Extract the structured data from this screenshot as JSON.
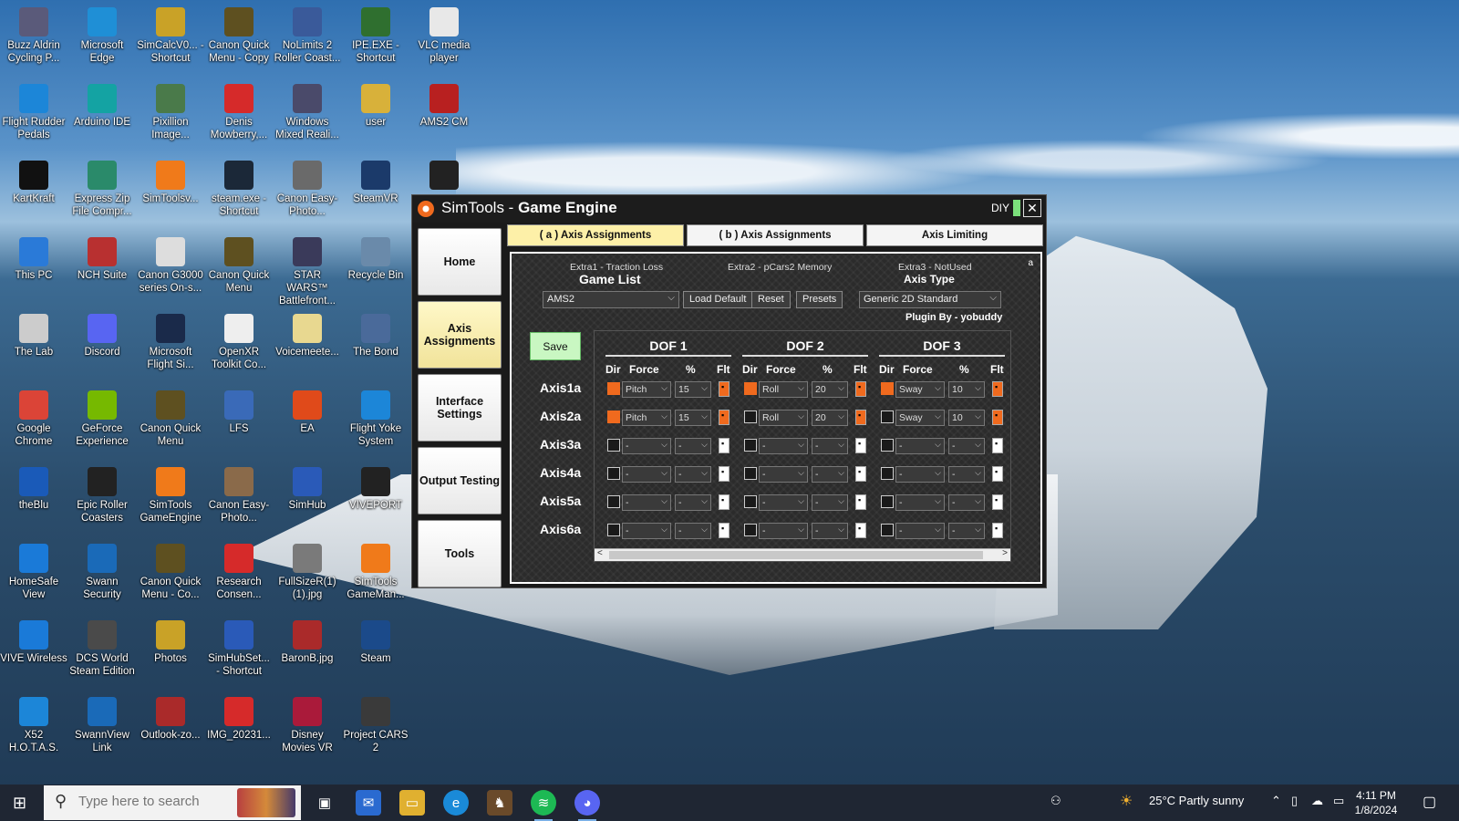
{
  "desktop_icons": [
    {
      "label": "Buzz Aldrin Cycling P...",
      "icon": "cycling-icon",
      "color": "#5a5a7a"
    },
    {
      "label": "Microsoft Edge",
      "icon": "edge-icon",
      "color": "#1f8fd6"
    },
    {
      "label": "SimCalcV0... - Shortcut",
      "icon": "folder-icon",
      "color": "#c9a227"
    },
    {
      "label": "Canon Quick Menu - Copy",
      "icon": "canon-icon",
      "color": "#5e5020"
    },
    {
      "label": "NoLimits 2 Roller Coast...",
      "icon": "coaster-icon",
      "color": "#3a5a9a"
    },
    {
      "label": "IPE.EXE - Shortcut",
      "icon": "sun-icon",
      "color": "#2f6f2f"
    },
    {
      "label": "VLC media player",
      "icon": "file-icon",
      "color": "#e8e8e8"
    },
    {
      "label": "Flight Rudder Pedals",
      "icon": "joystick-icon",
      "color": "#1c86d8"
    },
    {
      "label": "Arduino IDE",
      "icon": "arduino-icon",
      "color": "#14a3a3"
    },
    {
      "label": "Pixillion Image...",
      "icon": "image-icon",
      "color": "#4a7a4a"
    },
    {
      "label": "Denis Mowberry,...",
      "icon": "pdf-icon",
      "color": "#d62a2a"
    },
    {
      "label": "Windows Mixed Reali...",
      "icon": "vr-icon",
      "color": "#4a4a6a"
    },
    {
      "label": "user",
      "icon": "folder-icon",
      "color": "#d8b13a"
    },
    {
      "label": "AMS2 CM",
      "icon": "ams-icon",
      "color": "#b82020"
    },
    {
      "label": "KartKraft",
      "icon": "kart-icon",
      "color": "#111111"
    },
    {
      "label": "Express Zip File Compr...",
      "icon": "zip-icon",
      "color": "#2a8a6a"
    },
    {
      "label": "SimToolsv...",
      "icon": "power-icon",
      "color": "#f07a1a"
    },
    {
      "label": "steam.exe - Shortcut",
      "icon": "steam-icon",
      "color": "#1b2838"
    },
    {
      "label": "Canon Easy-Photo...",
      "icon": "camera-icon",
      "color": "#6a6a6a"
    },
    {
      "label": "SteamVR",
      "icon": "steamvr-icon",
      "color": "#1b3a6a"
    },
    {
      "label": "",
      "icon": "app-icon",
      "color": "#222222"
    },
    {
      "label": "This PC",
      "icon": "monitor-icon",
      "color": "#2a7ad8"
    },
    {
      "label": "NCH Suite",
      "icon": "nch-icon",
      "color": "#b83030"
    },
    {
      "label": "Canon G3000 series On-s...",
      "icon": "canon-icon",
      "color": "#dddddd"
    },
    {
      "label": "Canon Quick Menu",
      "icon": "canon-icon",
      "color": "#5e5020"
    },
    {
      "label": "STAR WARS™ Battlefront...",
      "icon": "starwars-icon",
      "color": "#3a3a5a"
    },
    {
      "label": "Recycle Bin",
      "icon": "recycle-icon",
      "color": "#6a8aaa"
    },
    {
      "label": "The Lab",
      "icon": "lab-icon",
      "color": "#cccccc"
    },
    {
      "label": "Discord",
      "icon": "discord-icon",
      "color": "#5865f2"
    },
    {
      "label": "Microsoft Flight Si...",
      "icon": "flightsim-icon",
      "color": "#1a2a4a"
    },
    {
      "label": "OpenXR Toolkit Co...",
      "icon": "openxr-icon",
      "color": "#eeeeee"
    },
    {
      "label": "Voicemeete...",
      "icon": "file-icon",
      "color": "#e8d890"
    },
    {
      "label": "The Bond",
      "icon": "app-icon",
      "color": "#4a6a9a"
    },
    {
      "label": "Google Chrome",
      "icon": "chrome-icon",
      "color": "#db4437"
    },
    {
      "label": "GeForce Experience",
      "icon": "nvidia-icon",
      "color": "#76b900"
    },
    {
      "label": "Canon Quick Menu",
      "icon": "canon-icon",
      "color": "#5e5020"
    },
    {
      "label": "LFS",
      "icon": "lfs-icon",
      "color": "#3a6ab8"
    },
    {
      "label": "EA",
      "icon": "ea-icon",
      "color": "#e04a1a"
    },
    {
      "label": "Flight Yoke System",
      "icon": "joystick-icon",
      "color": "#1c86d8"
    },
    {
      "label": "theBlu",
      "icon": "whale-icon",
      "color": "#1a5ab8"
    },
    {
      "label": "Epic Roller Coasters",
      "icon": "epic-icon",
      "color": "#222222"
    },
    {
      "label": "SimTools GameEngine",
      "icon": "simtools-icon",
      "color": "#f07a1a"
    },
    {
      "label": "Canon Easy-Photo...",
      "icon": "camera-icon",
      "color": "#8a6a4a"
    },
    {
      "label": "SimHub",
      "icon": "gamepad-icon",
      "color": "#2a5ab8"
    },
    {
      "label": "VIVEPORT",
      "icon": "viveport-icon",
      "color": "#222222"
    },
    {
      "label": "HomeSafe View",
      "icon": "homesafe-icon",
      "color": "#1a7ad8"
    },
    {
      "label": "Swann Security",
      "icon": "swann-icon",
      "color": "#1a6ab8"
    },
    {
      "label": "Canon Quick Menu - Co...",
      "icon": "canon-icon",
      "color": "#5e5020"
    },
    {
      "label": "Research Consen...",
      "icon": "pdf-icon",
      "color": "#d62a2a"
    },
    {
      "label": "FullSizeR(1) (1).jpg",
      "icon": "image-icon",
      "color": "#7a7a7a"
    },
    {
      "label": "SimTools GameMan...",
      "icon": "simtools-icon",
      "color": "#f07a1a"
    },
    {
      "label": "VIVE Wireless",
      "icon": "wireless-icon",
      "color": "#1a7ad8"
    },
    {
      "label": "DCS World Steam Edition",
      "icon": "dcs-icon",
      "color": "#4a4a4a"
    },
    {
      "label": "Photos",
      "icon": "photos-icon",
      "color": "#c9a227"
    },
    {
      "label": "SimHubSet... - Shortcut",
      "icon": "gamepad-icon",
      "color": "#2a5ab8"
    },
    {
      "label": "BaronB.jpg",
      "icon": "image-icon",
      "color": "#aa2a2a"
    },
    {
      "label": "Steam",
      "icon": "steam-icon",
      "color": "#1b4a8a"
    },
    {
      "label": "X52 H.O.T.A.S.",
      "icon": "joystick-icon",
      "color": "#1c86d8"
    },
    {
      "label": "SwannView Link",
      "icon": "swann-icon",
      "color": "#1a6ab8"
    },
    {
      "label": "Outlook-zo...",
      "icon": "image-icon",
      "color": "#aa2a2a"
    },
    {
      "label": "IMG_20231...",
      "icon": "pdf-icon",
      "color": "#d62a2a"
    },
    {
      "label": "Disney Movies VR",
      "icon": "disney-icon",
      "color": "#aa1a3a"
    },
    {
      "label": "Project CARS 2",
      "icon": "pcars-icon",
      "color": "#3a3a3a"
    }
  ],
  "window": {
    "title_prefix": "SimTools - ",
    "title_bold": "Game Engine",
    "diy": "DIY",
    "close": "✕"
  },
  "nav": {
    "home": "Home",
    "axis": "Axis Assignments",
    "interface": "Interface Settings",
    "output": "Output Testing",
    "tools": "Tools"
  },
  "tabs": {
    "a": "( a ) Axis Assignments",
    "b": "( b ) Axis Assignments",
    "limit": "Axis Limiting"
  },
  "panel": {
    "extra1": "Extra1 - Traction Loss",
    "extra2": "Extra2 - pCars2 Memory",
    "extra3": "Extra3 - NotUsed",
    "corner": "a",
    "game_list_label": "Game List",
    "game_list_value": "AMS2",
    "load_default": "Load Default",
    "reset": "Reset",
    "presets": "Presets",
    "axis_type_label": "Axis Type",
    "axis_type_value": "Generic 2D Standard",
    "plugin_by": "Plugin By - yobuddy",
    "save": "Save"
  },
  "dof_headers": [
    "DOF 1",
    "DOF 2",
    "DOF 3"
  ],
  "col_headers": {
    "dir": "Dir",
    "force": "Force",
    "pct": "%",
    "flt": "Flt"
  },
  "axes": [
    {
      "label": "Axis1a",
      "dofs": [
        {
          "dir": true,
          "force": "Pitch",
          "pct": "15",
          "flt": true
        },
        {
          "dir": true,
          "force": "Roll",
          "pct": "20",
          "flt": true
        },
        {
          "dir": true,
          "force": "Sway",
          "pct": "10",
          "flt": true
        }
      ]
    },
    {
      "label": "Axis2a",
      "dofs": [
        {
          "dir": true,
          "force": "Pitch",
          "pct": "15",
          "flt": true
        },
        {
          "dir": false,
          "force": "Roll",
          "pct": "20",
          "flt": true
        },
        {
          "dir": false,
          "force": "Sway",
          "pct": "10",
          "flt": true
        }
      ]
    },
    {
      "label": "Axis3a",
      "dofs": [
        {
          "dir": false,
          "force": "-",
          "pct": "-",
          "flt": false
        },
        {
          "dir": false,
          "force": "-",
          "pct": "-",
          "flt": false
        },
        {
          "dir": false,
          "force": "-",
          "pct": "-",
          "flt": false
        }
      ]
    },
    {
      "label": "Axis4a",
      "dofs": [
        {
          "dir": false,
          "force": "-",
          "pct": "-",
          "flt": false
        },
        {
          "dir": false,
          "force": "-",
          "pct": "-",
          "flt": false
        },
        {
          "dir": false,
          "force": "-",
          "pct": "-",
          "flt": false
        }
      ]
    },
    {
      "label": "Axis5a",
      "dofs": [
        {
          "dir": false,
          "force": "-",
          "pct": "-",
          "flt": false
        },
        {
          "dir": false,
          "force": "-",
          "pct": "-",
          "flt": false
        },
        {
          "dir": false,
          "force": "-",
          "pct": "-",
          "flt": false
        }
      ]
    },
    {
      "label": "Axis6a",
      "dofs": [
        {
          "dir": false,
          "force": "-",
          "pct": "-",
          "flt": false
        },
        {
          "dir": false,
          "force": "-",
          "pct": "-",
          "flt": false
        },
        {
          "dir": false,
          "force": "-",
          "pct": "-",
          "flt": false
        }
      ]
    }
  ],
  "taskbar": {
    "search_placeholder": "Type here to search",
    "apps": [
      "task-view-icon",
      "mail-icon",
      "file-explorer-icon",
      "edge-icon",
      "game-icon",
      "spotify-icon",
      "discord-icon"
    ],
    "weather": "25°C  Partly sunny",
    "time": "4:11 PM",
    "date": "1/8/2024"
  },
  "colors": {
    "accent": "#f06a1e",
    "active_tab": "#fdf0a8",
    "save": "#c9f7c2"
  }
}
